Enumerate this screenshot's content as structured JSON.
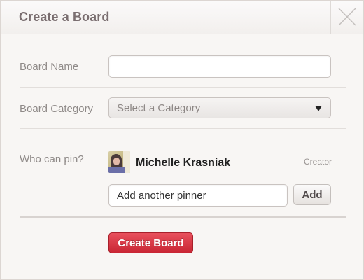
{
  "dialog": {
    "title": "Create a Board",
    "close_icon": "close-x-icon"
  },
  "form": {
    "board_name": {
      "label": "Board Name",
      "value": "",
      "placeholder": ""
    },
    "board_category": {
      "label": "Board Category",
      "selected": "Select a Category",
      "arrow_icon": "caret-down-icon"
    },
    "who_can_pin": {
      "label": "Who can pin?",
      "pinners": [
        {
          "name": "Michelle Krasniak",
          "role": "Creator"
        }
      ],
      "add_pinner_input": {
        "value": "Add another pinner",
        "placeholder": ""
      },
      "add_button_label": "Add"
    },
    "submit_label": "Create Board"
  },
  "colors": {
    "accent": "#cb2d3a",
    "title_text": "#7a6e70",
    "label_text": "#8f8a88",
    "background": "#f8f6f4"
  }
}
